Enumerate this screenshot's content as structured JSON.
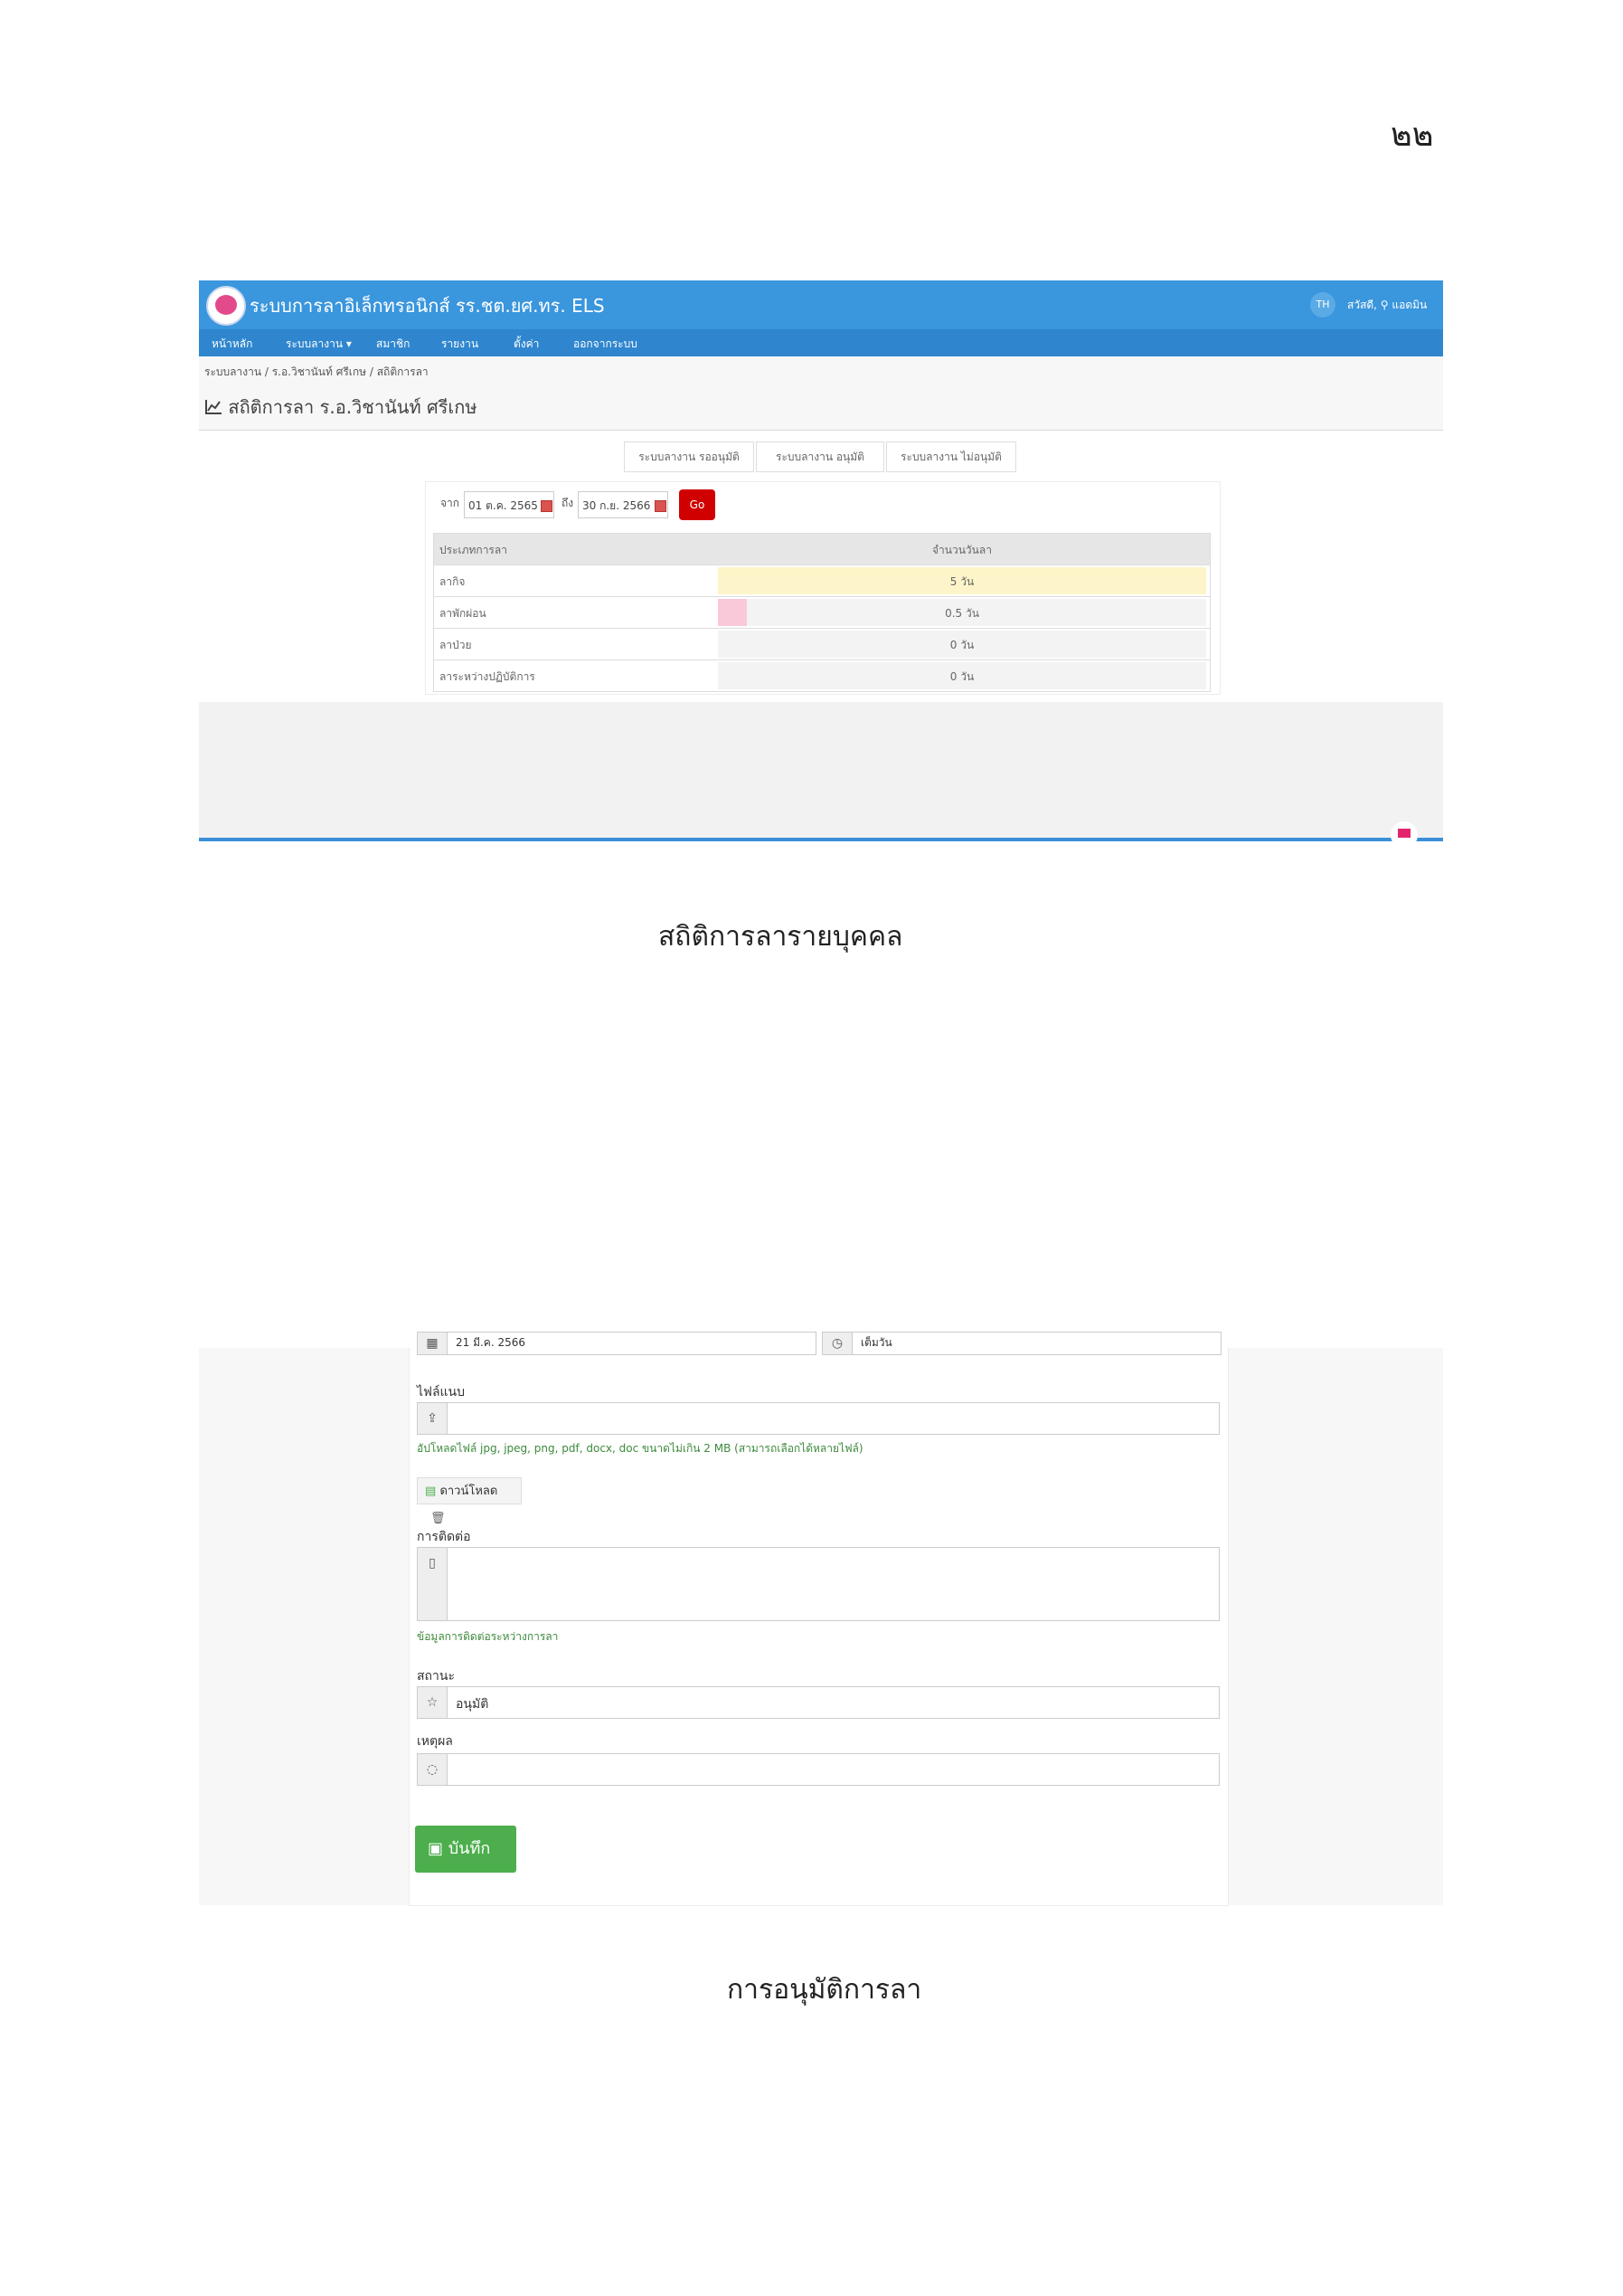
{
  "page_number": "๒๒",
  "screenshot1": {
    "app_title": "ระบบการลาอิเล็กทรอนิกส์ รร.ชต.ยศ.ทร. ELS",
    "lang": "TH",
    "greeting": "สวัสดี, ⚲ แอดมิน",
    "nav": [
      "หน้าหลัก",
      "ระบบลางาน ▾",
      "สมาชิก",
      "รายงาน",
      "ตั้งค่า",
      "ออกจากระบบ"
    ],
    "breadcrumb": "ระบบลางาน / ร.อ.วิชานันท์ ศรีเกษ / สถิติการลา",
    "heading": "สถิติการลา ร.อ.วิชานันท์ ศรีเกษ",
    "tabs": [
      "ระบบลางาน รออนุมัติ",
      "ระบบลางาน อนุมัติ",
      "ระบบลางาน ไม่อนุมัติ"
    ],
    "from_label": "จาก",
    "from_date": "01 ต.ค. 2565",
    "to_label": "ถึง",
    "to_date": "30 ก.ย. 2566",
    "go_label": "Go",
    "table_headers": [
      "ประเภทการลา",
      "จำนวนวันลา"
    ],
    "rows": [
      {
        "type": "ลากิจ",
        "value": "5 วัน",
        "fill": 1.0,
        "color": "#fdf5c9"
      },
      {
        "type": "ลาพักผ่อน",
        "value": "0.5 วัน",
        "fill": 0.06,
        "color": "#f9c9d9"
      },
      {
        "type": "ลาป่วย",
        "value": "0 วัน",
        "fill": 0,
        "color": "#ffffff"
      },
      {
        "type": "ลาระหว่างปฏิบัติการ",
        "value": "0 วัน",
        "fill": 0,
        "color": "#ffffff"
      }
    ]
  },
  "caption1": "สถิติการลารายบุคคล",
  "screenshot2": {
    "top_date": "21 มี.ค. 2566",
    "top_time": "เต็มวัน",
    "attach_label": "ไฟล์แนบ",
    "attach_help": "อัปโหลดไฟล์ jpg, jpeg, png, pdf, docx, doc ขนาดไม่เกิน 2 MB (สามารถเลือกได้หลายไฟล์)",
    "download_label": "ดาวน์โหลด",
    "contact_label": "การติดต่อ",
    "contact_help": "ข้อมูลการติดต่อระหว่างการลา",
    "status_label": "สถานะ",
    "status_value": "อนุมัติ",
    "reason_label": "เหตุผล",
    "reason_value": "",
    "save_label": "บันทึก"
  },
  "caption2": "การอนุมัติการลา"
}
